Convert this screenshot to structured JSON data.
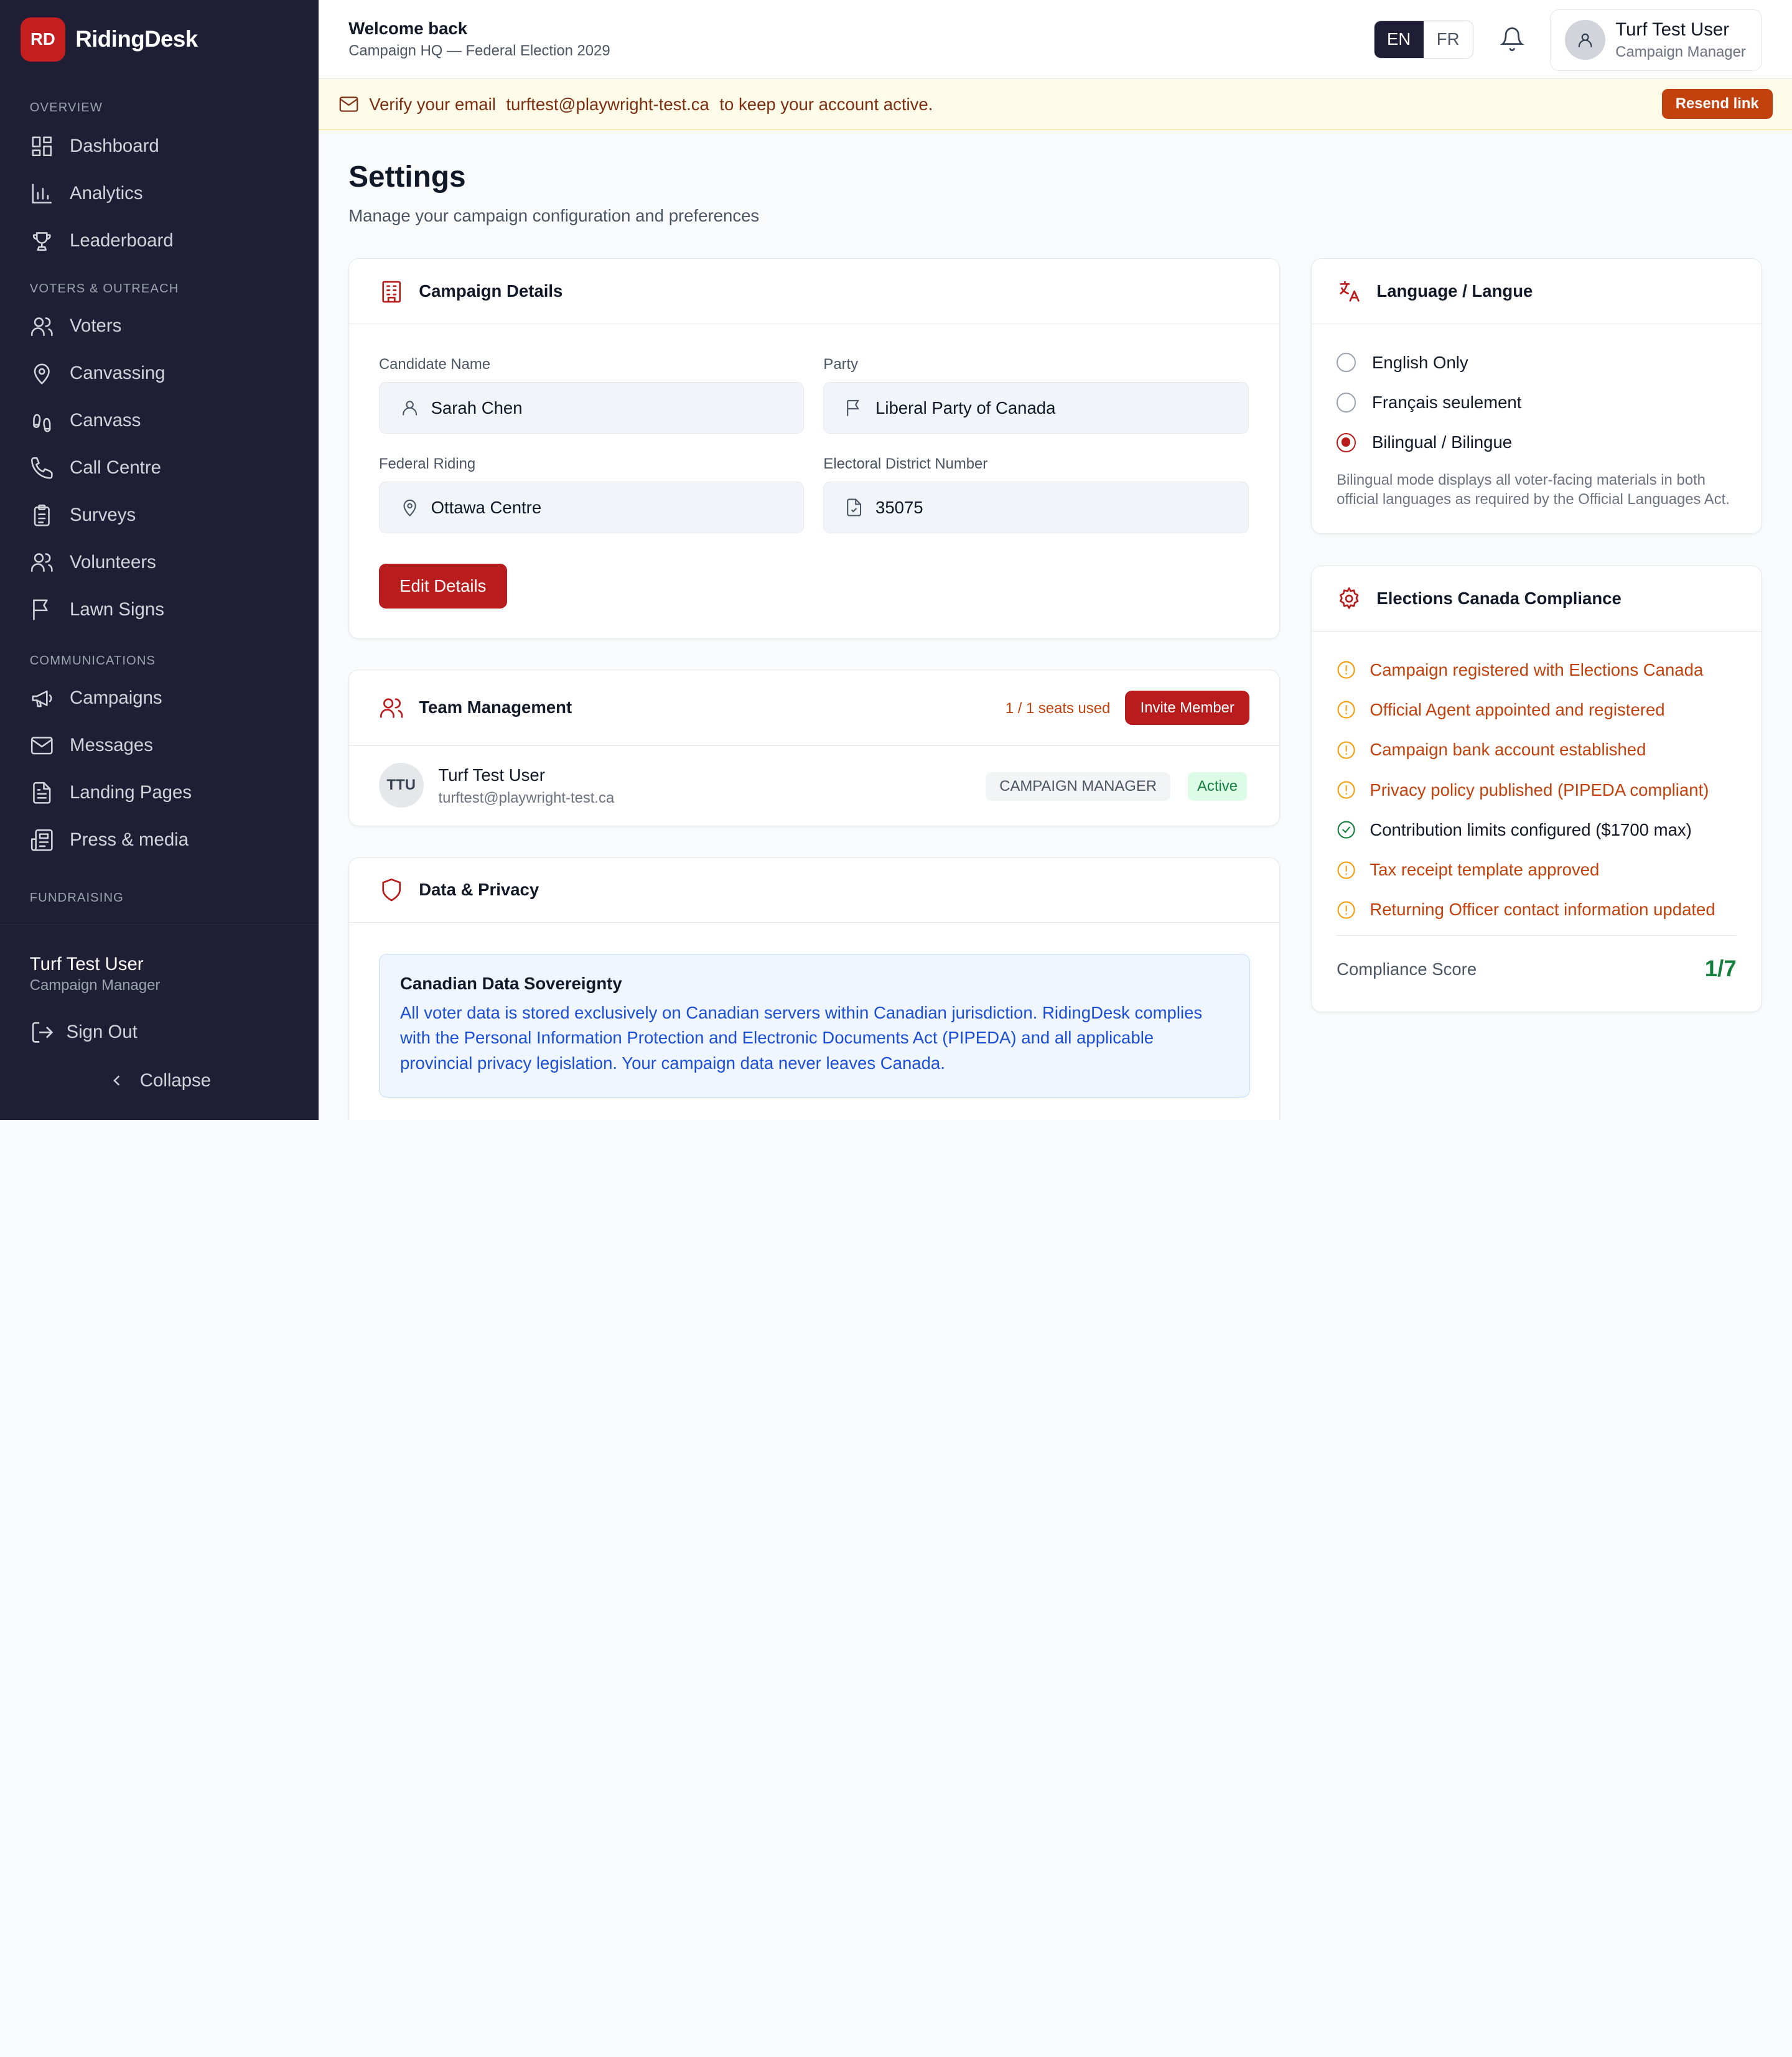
{
  "brand": {
    "badge": "RD",
    "name": "RidingDesk"
  },
  "nav": {
    "sections": [
      "Overview",
      "Voters & Outreach",
      "Communications",
      "Fundraising"
    ],
    "items": [
      "Dashboard",
      "Analytics",
      "Leaderboard",
      "Voters",
      "Canvassing",
      "Canvass",
      "Call Centre",
      "Surveys",
      "Volunteers",
      "Lawn Signs",
      "Campaigns",
      "Messages",
      "Landing Pages",
      "Press & media"
    ]
  },
  "sidebar_user": {
    "name": "Turf Test User",
    "role": "Campaign Manager",
    "signout": "Sign Out",
    "collapse": "Collapse"
  },
  "topbar": {
    "title": "Welcome back",
    "subtitle": "Campaign HQ — Federal Election 2029",
    "lang_en": "EN",
    "lang_fr": "FR",
    "user_name": "Turf Test User",
    "user_role": "Campaign Manager"
  },
  "banner": {
    "prefix": "Verify your email",
    "email": "turftest@playwright-test.ca",
    "suffix": "to keep your account active.",
    "button": "Resend link"
  },
  "page": {
    "title": "Settings",
    "subtitle": "Manage your campaign configuration and preferences"
  },
  "campaign": {
    "title": "Campaign Details",
    "candidate_label": "Candidate Name",
    "candidate": "Sarah Chen",
    "party_label": "Party",
    "party": "Liberal Party of Canada",
    "riding_label": "Federal Riding",
    "riding": "Ottawa Centre",
    "district_label": "Electoral District Number",
    "district": "35075",
    "edit_button": "Edit Details"
  },
  "team": {
    "title": "Team Management",
    "seats": "1 / 1 seats used",
    "invite": "Invite Member",
    "member": {
      "initials": "TTU",
      "name": "Turf Test User",
      "email": "turftest@playwright-test.ca",
      "role": "CAMPAIGN MANAGER",
      "status": "Active"
    }
  },
  "privacy": {
    "title": "Data & Privacy",
    "sovereignty_title": "Canadian Data Sovereignty",
    "sovereignty_text": "All voter data is stored exclusively on Canadian servers within Canadian jurisdiction. RidingDesk complies with the Personal Information Protection and Electronic Documents Act (PIPEDA) and all applicable provincial privacy legislation. Your campaign data never leaves Canada."
  },
  "language": {
    "title": "Language / Langue",
    "options": [
      "English Only",
      "Français seulement",
      "Bilingual / Bilingue"
    ],
    "selected": "Bilingual / Bilingue",
    "note": "Bilingual mode displays all voter-facing materials in both official languages as required by the Official Languages Act."
  },
  "compliance": {
    "title": "Elections Canada Compliance",
    "items": [
      {
        "label": "Campaign registered with Elections Canada",
        "status": "pending"
      },
      {
        "label": "Official Agent appointed and registered",
        "status": "pending"
      },
      {
        "label": "Campaign bank account established",
        "status": "pending"
      },
      {
        "label": "Privacy policy published (PIPEDA compliant)",
        "status": "pending"
      },
      {
        "label": "Contribution limits configured ($1700 max)",
        "status": "done"
      },
      {
        "label": "Tax receipt template approved",
        "status": "pending"
      },
      {
        "label": "Returning Officer contact information updated",
        "status": "pending"
      }
    ],
    "score_label": "Compliance Score",
    "score": "1/7"
  },
  "colors": {
    "accent": "#b91c1c",
    "sidebar": "#1e1e35",
    "warning": "#c2410c",
    "success": "#15803d"
  }
}
